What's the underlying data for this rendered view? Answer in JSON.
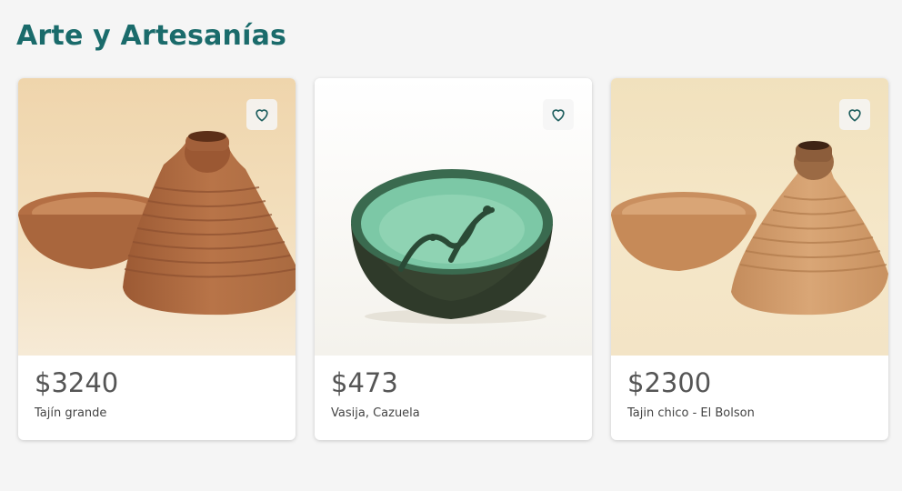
{
  "section": {
    "title": "Arte y Artesanías"
  },
  "products": [
    {
      "price": "$3240",
      "name": "Tajín grande",
      "favorite_icon": "heart-outline-icon"
    },
    {
      "price": "$473",
      "name": "Vasija, Cazuela",
      "favorite_icon": "heart-outline-icon"
    },
    {
      "price": "$2300",
      "name": "Tajin chico - El Bolson",
      "favorite_icon": "heart-outline-icon"
    }
  ],
  "colors": {
    "title": "#1a6b6b",
    "heart": "#1f5f5f",
    "price": "#555555"
  }
}
